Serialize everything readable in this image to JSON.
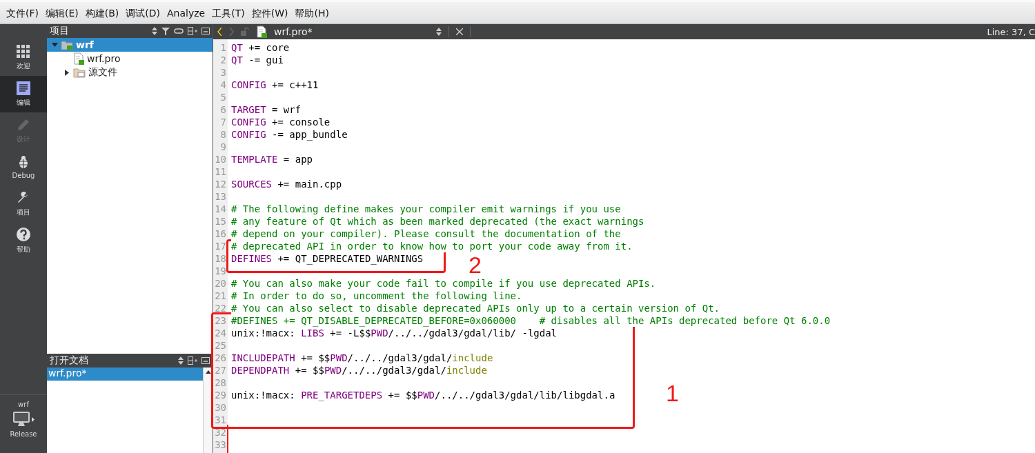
{
  "menu_bar": [
    "文件(F)",
    "编辑(E)",
    "构建(B)",
    "调试(D)",
    "Analyze",
    "工具(T)",
    "控件(W)",
    "帮助(H)"
  ],
  "mode_bar": {
    "items": [
      {
        "kind": "welcome",
        "label": "欢迎",
        "selected": false,
        "disabled": false
      },
      {
        "kind": "edit",
        "label": "编辑",
        "selected": true,
        "disabled": false
      },
      {
        "kind": "design",
        "label": "设计",
        "selected": false,
        "disabled": true
      },
      {
        "kind": "debug",
        "label": "Debug",
        "selected": false,
        "disabled": false
      },
      {
        "kind": "projects",
        "label": "项目",
        "selected": false,
        "disabled": false
      },
      {
        "kind": "help",
        "label": "帮助",
        "selected": false,
        "disabled": false
      }
    ],
    "project": "wrf",
    "build": "Release"
  },
  "project_panel": {
    "title": "项目",
    "tree": [
      {
        "label": "wrf",
        "kind": "project",
        "selected": true,
        "expanded": true,
        "children": [
          {
            "label": "wrf.pro",
            "kind": "file",
            "selected": false
          },
          {
            "label": "源文件",
            "kind": "folder",
            "selected": false,
            "expanded": false
          }
        ]
      }
    ]
  },
  "open_documents": {
    "title": "打开文档",
    "items": [
      {
        "label": "wrf.pro*",
        "selected": true
      }
    ]
  },
  "editor": {
    "file": "wrf.pro*",
    "position": "Line: 37, C",
    "back_enabled": true,
    "forward_enabled": false,
    "lines": [
      {
        "number": "1",
        "tokens": [
          {
            "kind": "keyword",
            "text": "QT"
          },
          {
            "kind": "plain",
            "text": " += core"
          }
        ]
      },
      {
        "number": "2",
        "tokens": [
          {
            "kind": "keyword",
            "text": "QT"
          },
          {
            "kind": "plain",
            "text": " -= gui"
          }
        ]
      },
      {
        "number": "3"
      },
      {
        "number": "4",
        "tokens": [
          {
            "kind": "keyword",
            "text": "CONFIG"
          },
          {
            "kind": "plain",
            "text": " += c++11"
          }
        ]
      },
      {
        "number": "5"
      },
      {
        "number": "6",
        "tokens": [
          {
            "kind": "keyword",
            "text": "TARGET"
          },
          {
            "kind": "plain",
            "text": " = wrf"
          }
        ]
      },
      {
        "number": "7",
        "tokens": [
          {
            "kind": "keyword",
            "text": "CONFIG"
          },
          {
            "kind": "plain",
            "text": " += console"
          }
        ]
      },
      {
        "number": "8",
        "tokens": [
          {
            "kind": "keyword",
            "text": "CONFIG"
          },
          {
            "kind": "plain",
            "text": " -= app_bundle"
          }
        ]
      },
      {
        "number": "9"
      },
      {
        "number": "10",
        "tokens": [
          {
            "kind": "keyword",
            "text": "TEMPLATE"
          },
          {
            "kind": "plain",
            "text": " = app"
          }
        ]
      },
      {
        "number": "11"
      },
      {
        "number": "12",
        "tokens": [
          {
            "kind": "keyword",
            "text": "SOURCES"
          },
          {
            "kind": "plain",
            "text": " += main.cpp"
          }
        ]
      },
      {
        "number": "13"
      },
      {
        "number": "14",
        "tokens": [
          {
            "kind": "comment",
            "text": "# The following define makes your compiler emit warnings if you use"
          }
        ]
      },
      {
        "number": "15",
        "tokens": [
          {
            "kind": "comment",
            "text": "# any feature of Qt which as been marked deprecated (the exact warnings"
          }
        ]
      },
      {
        "number": "16",
        "tokens": [
          {
            "kind": "comment",
            "text": "# depend on your compiler). Please consult the documentation of the"
          }
        ]
      },
      {
        "number": "17",
        "tokens": [
          {
            "kind": "comment",
            "text": "# deprecated API in order to know how to port your code away from it."
          }
        ]
      },
      {
        "number": "18",
        "tokens": [
          {
            "kind": "keyword",
            "text": "DEFINES"
          },
          {
            "kind": "plain",
            "text": " += QT_DEPRECATED_WARNINGS"
          }
        ]
      },
      {
        "number": "19"
      },
      {
        "number": "20",
        "tokens": [
          {
            "kind": "comment",
            "text": "# You can also make your code fail to compile if you use deprecated APIs."
          }
        ]
      },
      {
        "number": "21",
        "tokens": [
          {
            "kind": "comment",
            "text": "# In order to do so, uncomment the following line."
          }
        ]
      },
      {
        "number": "22",
        "tokens": [
          {
            "kind": "comment",
            "text": "# You can also select to disable deprecated APIs only up to a certain version of Qt."
          }
        ]
      },
      {
        "number": "23",
        "tokens": [
          {
            "kind": "comment",
            "text": "#DEFINES += QT_DISABLE_DEPRECATED_BEFORE=0x060000    # disables all the APIs deprecated before Qt 6.0.0"
          }
        ]
      },
      {
        "number": "24",
        "tokens": [
          {
            "kind": "plain",
            "text": "unix:!macx: "
          },
          {
            "kind": "keyword",
            "text": "LIBS"
          },
          {
            "kind": "plain",
            "text": " += -L$$"
          },
          {
            "kind": "keyword",
            "text": "PWD"
          },
          {
            "kind": "plain",
            "text": "/../../gdal3/gdal/lib/ -lgdal"
          }
        ]
      },
      {
        "number": "25"
      },
      {
        "number": "26",
        "tokens": [
          {
            "kind": "keyword",
            "text": "INCLUDEPATH"
          },
          {
            "kind": "plain",
            "text": " += $$"
          },
          {
            "kind": "keyword",
            "text": "PWD"
          },
          {
            "kind": "plain",
            "text": "/../../gdal3/gdal/"
          },
          {
            "kind": "path",
            "text": "include"
          }
        ]
      },
      {
        "number": "27",
        "tokens": [
          {
            "kind": "keyword",
            "text": "DEPENDPATH"
          },
          {
            "kind": "plain",
            "text": " += $$"
          },
          {
            "kind": "keyword",
            "text": "PWD"
          },
          {
            "kind": "plain",
            "text": "/../../gdal3/gdal/"
          },
          {
            "kind": "path",
            "text": "include"
          }
        ]
      },
      {
        "number": "28"
      },
      {
        "number": "29",
        "tokens": [
          {
            "kind": "plain",
            "text": "unix:!macx: "
          },
          {
            "kind": "keyword",
            "text": "PRE_TARGETDEPS"
          },
          {
            "kind": "plain",
            "text": " += $$"
          },
          {
            "kind": "keyword",
            "text": "PWD"
          },
          {
            "kind": "plain",
            "text": "/../../gdal3/gdal/lib/libgdal.a"
          }
        ]
      },
      {
        "number": "30"
      },
      {
        "number": "31"
      },
      {
        "number": "32"
      },
      {
        "number": "33"
      }
    ]
  },
  "annotations": [
    {
      "label": "1"
    },
    {
      "label": "2"
    }
  ]
}
